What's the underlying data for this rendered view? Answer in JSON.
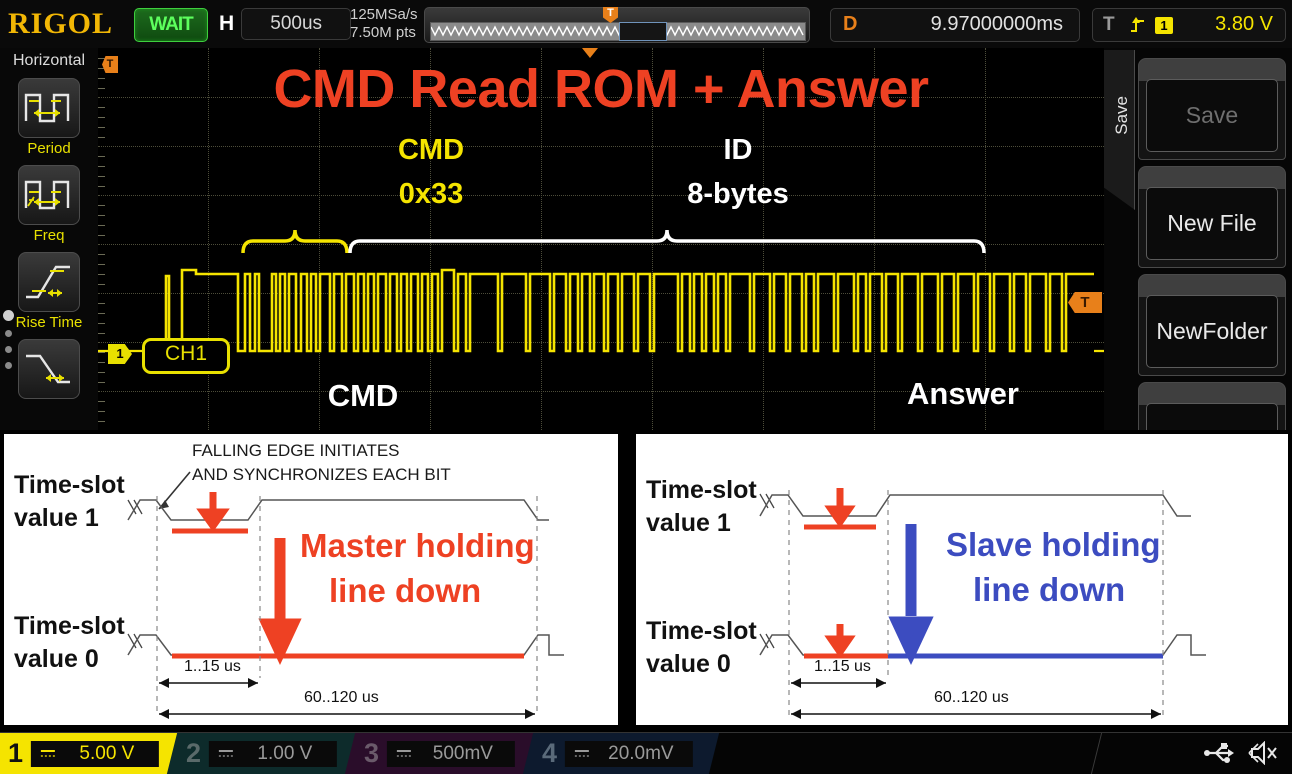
{
  "topbar": {
    "brand": "RIGOL",
    "run_status": "WAIT",
    "horizontal_key": "H",
    "horizontal_value": "500us",
    "sample_rate": "125MSa/s",
    "mem_depth": "7.50M pts",
    "nav_trigger_marker": "T",
    "delay_key": "D",
    "delay_value": "9.97000000ms",
    "trigger_key": "T",
    "trigger_edge_icon": "rising-edge-icon",
    "trigger_source": "1",
    "trigger_level": "3.80 V"
  },
  "left_sidebar": {
    "title": "Horizontal",
    "items": [
      {
        "label": "Period",
        "icon": "period-measure-icon"
      },
      {
        "label": "Freq",
        "icon": "frequency-measure-icon"
      },
      {
        "label": "Rise Time",
        "icon": "rise-time-measure-icon"
      },
      {
        "label": "",
        "icon": "fall-time-measure-icon"
      }
    ]
  },
  "right_sidebar": {
    "title": "Save",
    "buttons": [
      {
        "label": "Save",
        "disabled": true
      },
      {
        "label": "New File",
        "disabled": false
      },
      {
        "label": "NewFolder",
        "disabled": false
      },
      {
        "label": "",
        "disabled": false
      }
    ]
  },
  "scope": {
    "title": "CMD Read ROM + Answer",
    "channel_badge": "CH1",
    "channel_marker": "1",
    "trigger_left_marker": "T",
    "trigger_right_marker": "T",
    "annotations": {
      "cmd_top_line1": "CMD",
      "cmd_top_line2": "0x33",
      "id_top_line1": "ID",
      "id_top_line2": "8-bytes",
      "cmd_bottom": "CMD",
      "answer_bottom": "Answer"
    },
    "colors": {
      "channel1": "#F5E400",
      "title_red": "#EE4123",
      "trigger_orange": "#E8801A",
      "grid": "#4D4D3A"
    }
  },
  "diagram_left": {
    "callout_line1": "FALLING EDGE INITIATES",
    "callout_line2": "AND SYNCHRONIZES EACH BIT",
    "row1_label_line1": "Time-slot",
    "row1_label_line2": "value 1",
    "row2_label_line1": "Time-slot",
    "row2_label_line2": "value 0",
    "big_note_line1": "Master holding",
    "big_note_line2": "line down",
    "dim_short": "1..15 us",
    "dim_long": "60..120 us",
    "note_color": "#EE4123"
  },
  "diagram_right": {
    "row1_label_line1": "Time-slot",
    "row1_label_line2": "value 1",
    "row2_label_line1": "Time-slot",
    "row2_label_line2": "value 0",
    "big_note_line1": "Slave holding",
    "big_note_line2": "line down",
    "dim_short": "1..15 us",
    "dim_long": "60..120 us",
    "note_color": "#3C4CC0",
    "master_pulse_color": "#EE4123"
  },
  "bottom_bar": {
    "channels": [
      {
        "num": "1",
        "value": "5.00 V",
        "color": "#F5E400",
        "active": true
      },
      {
        "num": "2",
        "value": "1.00 V",
        "color": "#1FC4B0",
        "active": false
      },
      {
        "num": "3",
        "value": "500mV",
        "color": "#B13FB1",
        "active": false
      },
      {
        "num": "4",
        "value": "20.0mV",
        "color": "#2D74C8",
        "active": false
      }
    ],
    "icons": [
      {
        "name": "usb-icon"
      },
      {
        "name": "speaker-mute-icon"
      }
    ]
  }
}
